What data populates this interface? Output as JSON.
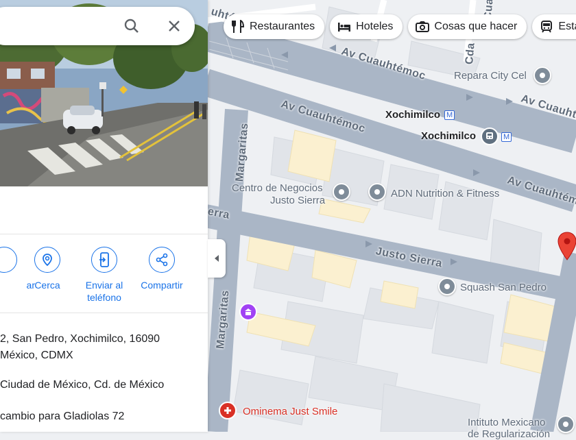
{
  "colors": {
    "accent": "#1a73e8",
    "road": "#aab6c6",
    "road_minor": "#ffffff",
    "block": "#eef0f3",
    "building": "#e1e4e9",
    "building_yellow": "#fbf0d0",
    "poi_red": "#d93025",
    "poi_purple": "#a142f4",
    "pin_gray": "#7f8c99"
  },
  "search": {
    "search_icon": "search-icon",
    "close_icon": "close-icon"
  },
  "actions": [
    {
      "label": "ar",
      "icon": "directions-icon"
    },
    {
      "label": "Cerca",
      "icon": "nearby-icon"
    },
    {
      "label": "Enviar al teléfono",
      "icon": "send-to-phone-icon"
    },
    {
      "label": "Compartir",
      "icon": "share-icon"
    }
  ],
  "info": {
    "address_line1": "2, San Pedro, Xochimilco, 16090",
    "address_line2": "México, CDMX",
    "locality": "Ciudad de México, Cd. de México",
    "plus_code": "cambio para Gladiolas 72"
  },
  "chips": [
    {
      "label": "Restaurantes",
      "icon": "restaurant-icon"
    },
    {
      "label": "Hoteles",
      "icon": "hotel-icon"
    },
    {
      "label": "Cosas que hacer",
      "icon": "camera-icon"
    },
    {
      "label": "Esta",
      "icon": "transit-icon"
    }
  ],
  "streets": {
    "cuauhtemoc_1": "Av Cuauhtémoc",
    "cuauhtemoc_2": "Av Cuauhtémoc",
    "cuauhtemoc_3": "Av Cuauhtémoc",
    "cuauhtemoc_4": "Av Cuauhtémoc",
    "justo_sierra": "Justo Sierra",
    "justo_sierra_left": "erra",
    "margaritas_1": "Margaritas",
    "margaritas_2": "Margaritas",
    "cd_partial": "Cda",
    "top_partial": "uhté",
    "top_right_partial": "Cuauht"
  },
  "places": {
    "repara": "Repara City Cel",
    "xochimilco_1": "Xochimilco",
    "xochimilco_2": "Xochimilco",
    "centro_1": "Centro de Negocios",
    "centro_2": "Justo Sierra",
    "adn": "ADN Nutrition & Fitness",
    "squash": "Squash San Pedro",
    "ominema": "Ominema Just Smile",
    "instituto_1": "Intituto Mexicano",
    "instituto_2": "de Regularización"
  },
  "metro_badge": "M"
}
